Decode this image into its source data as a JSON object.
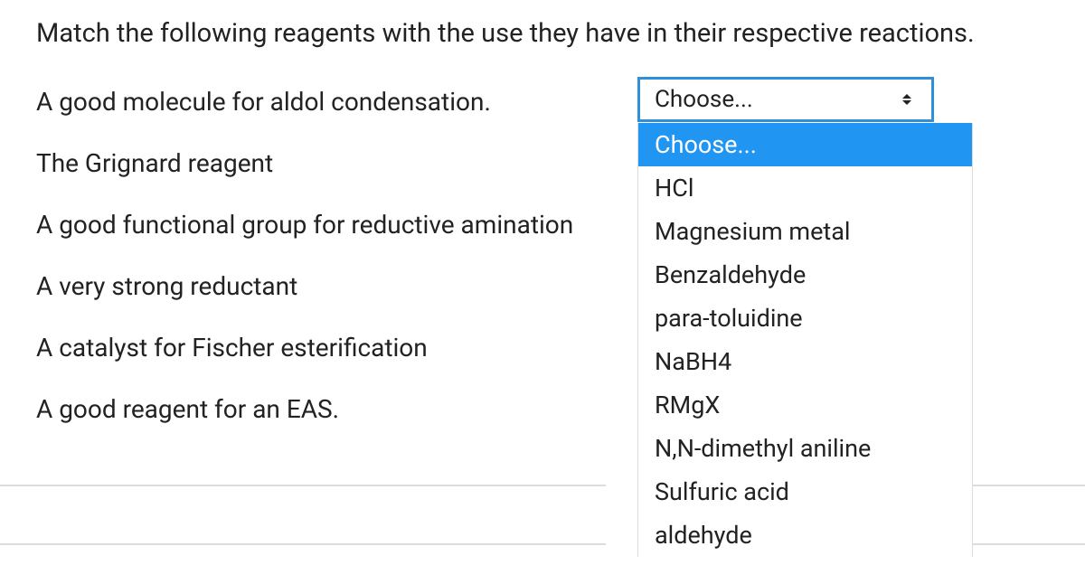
{
  "instruction": "Match the following reagents with the use they have in their respective reactions.",
  "selected_placeholder": "Choose...",
  "prompts": [
    "A good molecule for aldol condensation.",
    "The Grignard reagent",
    "A good functional group for reductive amination",
    "A very strong reductant",
    "A catalyst for Fischer esterification",
    "A good reagent for an EAS."
  ],
  "options": [
    "Choose...",
    "HCl",
    "Magnesium metal",
    "Benzaldehyde",
    "para-toluidine",
    "NaBH4",
    "RMgX",
    "N,N-dimethyl aniline",
    "Sulfuric acid",
    "aldehyde"
  ]
}
